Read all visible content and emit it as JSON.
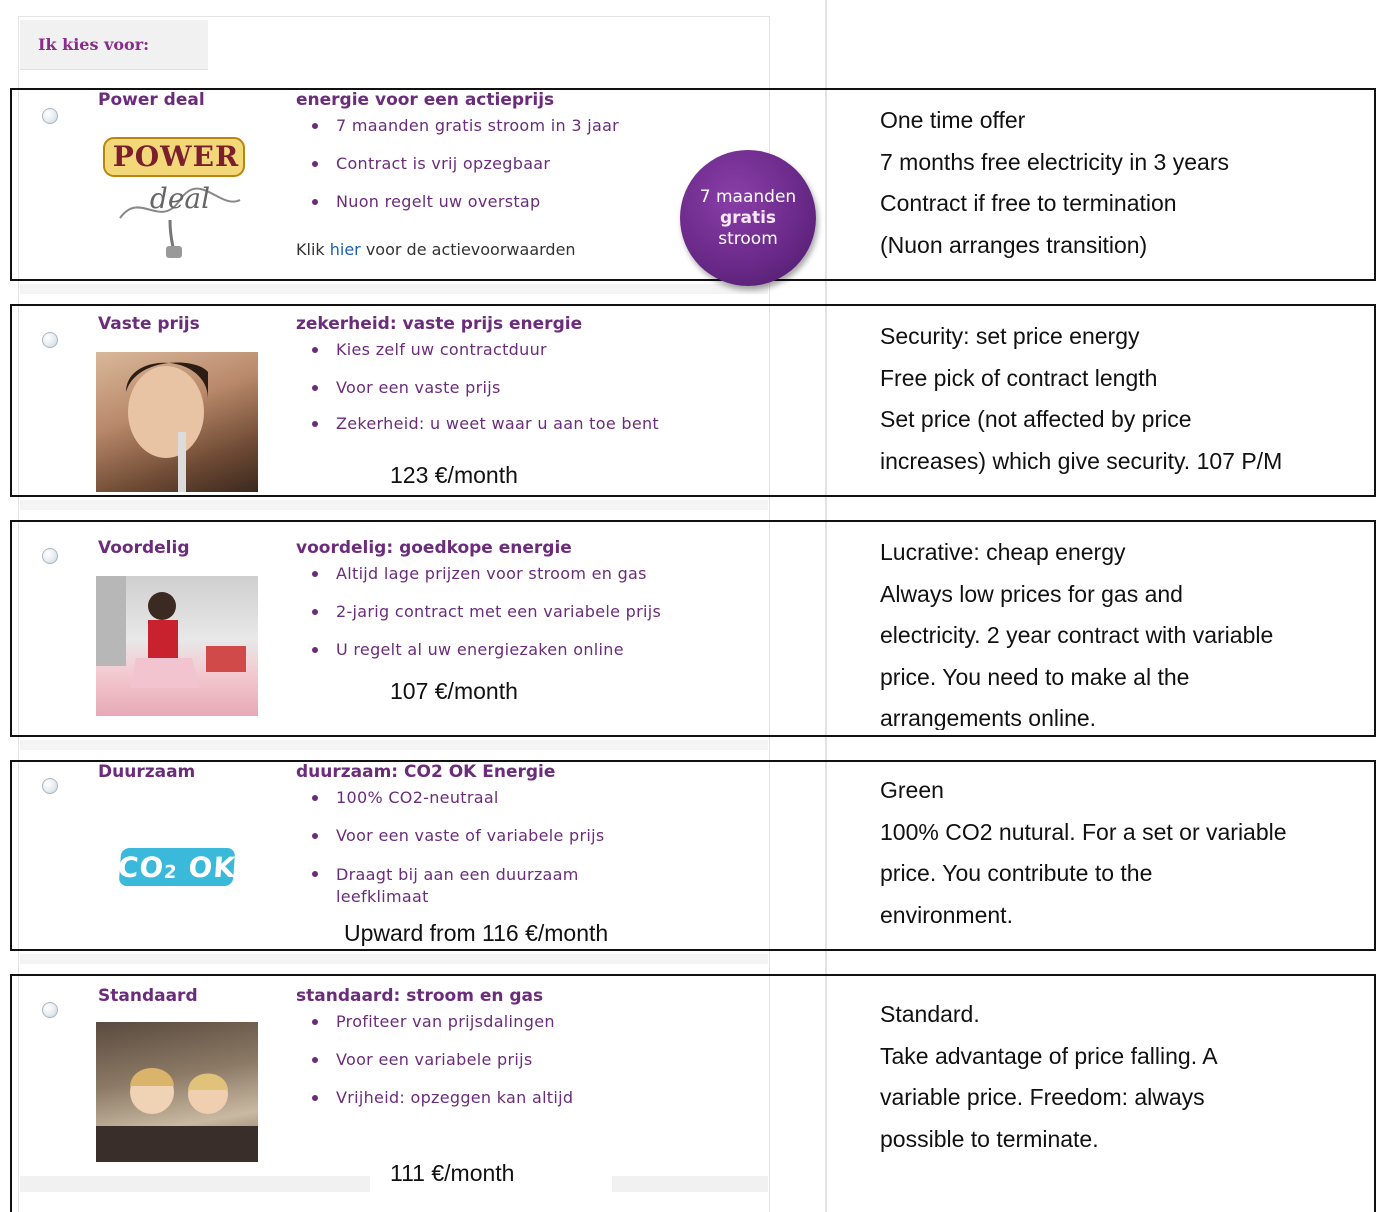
{
  "header": {
    "label": "Ik kies voor:"
  },
  "plans": [
    {
      "name": "Power deal",
      "title": "energie voor een actieprijs",
      "bullets": [
        "7 maanden gratis stroom in 3 jaar",
        "Contract is vrij opzegbaar",
        "Nuon regelt uw overstap"
      ],
      "klik": {
        "prefix": "Klik ",
        "link": "hier",
        "suffix": " voor de actievoorwaarden"
      },
      "logo_text": {
        "line1": "POWER",
        "line2": "deal"
      },
      "badge": {
        "line1": "7 maanden",
        "line2": "gratis",
        "line3": "stroom"
      },
      "desc": [
        "One time offer",
        "7 months free electricity in 3 years",
        "Contract if free to termination",
        "(Nuon arranges transition)"
      ]
    },
    {
      "name": "Vaste prijs",
      "title": "zekerheid: vaste prijs energie",
      "bullets": [
        "Kies zelf uw contractduur",
        "Voor een vaste prijs",
        "Zekerheid: u weet waar u aan toe bent"
      ],
      "price": "123 €/month",
      "desc": [
        "Security: set price energy",
        "Free pick of contract length",
        "Set price (not affected by price",
        "increases) which give security.  107 P/M"
      ]
    },
    {
      "name": "Voordelig",
      "title": "voordelig: goedkope energie",
      "bullets": [
        "Altijd lage prijzen voor stroom en gas",
        "2-jarig contract met een variabele prijs",
        "U regelt al uw energiezaken online"
      ],
      "price": "107 €/month",
      "desc": [
        "Lucrative: cheap energy",
        "Always low prices for gas and",
        "electricity. 2 year contract with variable",
        "price. You need to make al the",
        "arrangements online."
      ]
    },
    {
      "name": "Duurzaam",
      "title": "duurzaam: CO2 OK Energie",
      "bullets": [
        "100% CO2-neutraal",
        "Voor een vaste of variabele prijs",
        "Draagt bij aan een duurzaam leefklimaat"
      ],
      "logo_text": {
        "main": "CO",
        "sub": "2",
        "tail": " OK"
      },
      "price": "Upward from 116 €/month",
      "desc": [
        "Green",
        "100% CO2 nutural. For a set or variable",
        "price. You contribute to the",
        "environment."
      ]
    },
    {
      "name": "Standaard",
      "title": "standaard: stroom en gas",
      "bullets": [
        "Profiteer van prijsdalingen",
        "Voor een variabele prijs",
        "Vrijheid: opzeggen kan altijd"
      ],
      "price": "111 €/month",
      "desc": [
        "Standard.",
        "Take advantage of price falling. A",
        "variable price. Freedom: always",
        "possible to terminate."
      ]
    }
  ],
  "colors": {
    "accent": "#6b2c7c",
    "border": "#111111",
    "link": "#1a5fb4",
    "badge": "#6b2a8a"
  }
}
